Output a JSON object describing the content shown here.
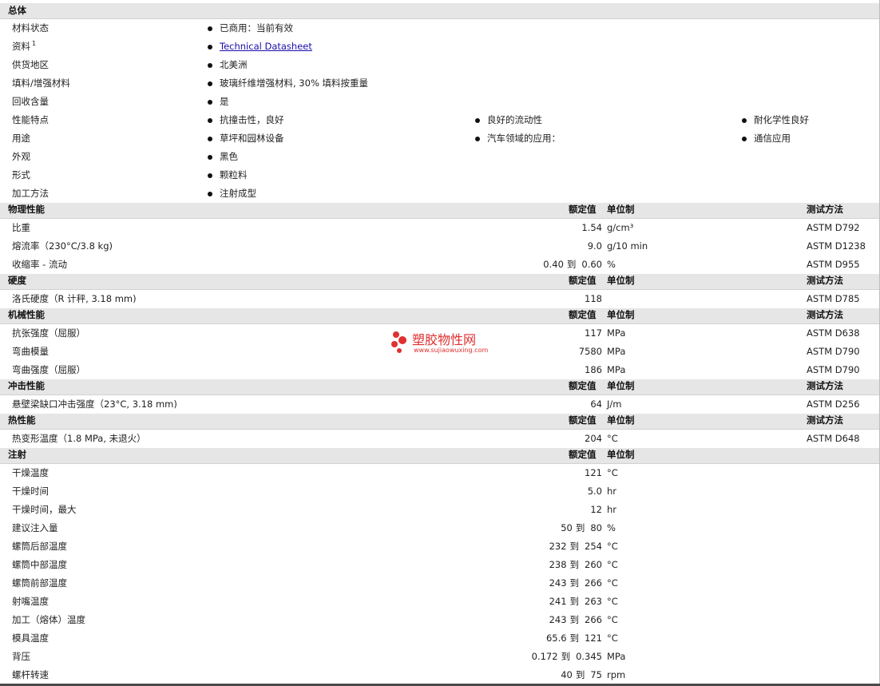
{
  "general": {
    "header": "总体",
    "rows": [
      {
        "label": "材料状态",
        "values": [
          "已商用：当前有效"
        ]
      },
      {
        "label": "资料",
        "sup": "1",
        "values": [
          "Technical Datasheet"
        ],
        "link": true
      },
      {
        "label": "供货地区",
        "values": [
          "北美洲"
        ]
      },
      {
        "label": "填料/增强材料",
        "values": [
          "玻璃纤维增强材料, 30% 填料按重量"
        ]
      },
      {
        "label": "回收含量",
        "values": [
          "是"
        ]
      },
      {
        "label": "性能特点",
        "values": [
          "抗撞击性，良好",
          "良好的流动性",
          "耐化学性良好"
        ]
      },
      {
        "label": "用途",
        "values": [
          "草坪和园林设备",
          "汽车领域的应用：",
          "通信应用"
        ]
      },
      {
        "label": "外观",
        "values": [
          "黑色"
        ]
      },
      {
        "label": "形式",
        "values": [
          "颗粒料"
        ]
      },
      {
        "label": "加工方法",
        "values": [
          "注射成型"
        ]
      }
    ]
  },
  "column_headers": {
    "nominal": "额定值",
    "unit": "单位制",
    "method": "测试方法"
  },
  "range_word": "到",
  "sections": [
    {
      "title": "物理性能",
      "method_col": true,
      "rows": [
        {
          "label": "比重",
          "value": "1.54",
          "unit": "g/cm³",
          "method": "ASTM D792"
        },
        {
          "label": "熔流率（230°C/3.8 kg)",
          "value": "9.0",
          "unit": "g/10 min",
          "method": "ASTM D1238"
        },
        {
          "label": "收缩率 - 流动",
          "value_from": "0.40",
          "value_to": "0.60",
          "unit": "%",
          "method": "ASTM D955"
        }
      ]
    },
    {
      "title": "硬度",
      "method_col": true,
      "rows": [
        {
          "label": "洛氏硬度（R 计秤, 3.18 mm)",
          "value": "118",
          "unit": "",
          "method": "ASTM D785"
        }
      ]
    },
    {
      "title": "机械性能",
      "method_col": true,
      "rows": [
        {
          "label": "抗张强度（屈服）",
          "value": "117",
          "unit": "MPa",
          "method": "ASTM D638"
        },
        {
          "label": "弯曲模量",
          "value": "7580",
          "unit": "MPa",
          "method": "ASTM D790"
        },
        {
          "label": "弯曲强度（屈服）",
          "value": "186",
          "unit": "MPa",
          "method": "ASTM D790"
        }
      ]
    },
    {
      "title": "冲击性能",
      "method_col": true,
      "rows": [
        {
          "label": "悬壁梁缺口冲击强度（23°C, 3.18 mm)",
          "value": "64",
          "unit": "J/m",
          "method": "ASTM D256"
        }
      ]
    },
    {
      "title": "热性能",
      "method_col": true,
      "rows": [
        {
          "label": "热变形温度（1.8 MPa, 未退火）",
          "value": "204",
          "unit": "°C",
          "method": "ASTM D648"
        }
      ]
    },
    {
      "title": "注射",
      "method_col": false,
      "rows": [
        {
          "label": "干燥温度",
          "value": "121",
          "unit": "°C"
        },
        {
          "label": "干燥时间",
          "value": "5.0",
          "unit": "hr"
        },
        {
          "label": "干燥时间，最大",
          "value": "12",
          "unit": "hr"
        },
        {
          "label": "建议注入量",
          "value_from": "50",
          "value_to": "80",
          "unit": "%"
        },
        {
          "label": "螺筒后部温度",
          "value_from": "232",
          "value_to": "254",
          "unit": "°C"
        },
        {
          "label": "螺筒中部温度",
          "value_from": "238",
          "value_to": "260",
          "unit": "°C"
        },
        {
          "label": "螺筒前部温度",
          "value_from": "243",
          "value_to": "266",
          "unit": "°C"
        },
        {
          "label": "射嘴温度",
          "value_from": "241",
          "value_to": "263",
          "unit": "°C"
        },
        {
          "label": "加工（熔体）温度",
          "value_from": "243",
          "value_to": "266",
          "unit": "°C"
        },
        {
          "label": "模具温度",
          "value_from": "65.6",
          "value_to": "121",
          "unit": "°C"
        },
        {
          "label": "背压",
          "value_from": "0.172",
          "value_to": "0.345",
          "unit": "MPa"
        },
        {
          "label": "螺杆转速",
          "value_from": "40",
          "value_to": "75",
          "unit": "rpm"
        }
      ]
    }
  ],
  "watermark": {
    "name": "塑胶物性网",
    "url": "www.sujiaowuxing.com",
    "color": "#e03030"
  }
}
